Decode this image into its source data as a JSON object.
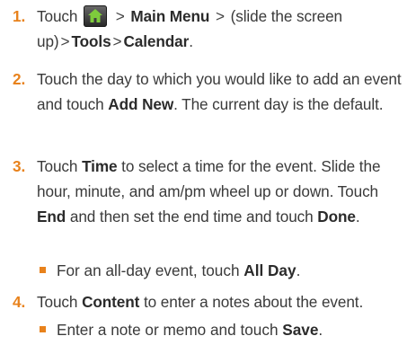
{
  "steps": [
    {
      "number": "1.",
      "prefix": "Touch",
      "icon": "home-icon",
      "path": [
        "Main Menu",
        "(slide the screen up)",
        "Tools",
        "Calendar"
      ],
      "separator": ">",
      "end": "."
    },
    {
      "number": "2.",
      "text_before": "Touch the day to which you would like to add an event and touch",
      "bold": "Add New",
      "text_after": ". The current day is the default."
    },
    {
      "number": "3.",
      "t1": "Touch",
      "b1": "Time",
      "t2": "to select a time for the event. Slide the hour, minute, and am/pm wheel up or down. Touch",
      "b2": "End",
      "t3": "and then set the end time and touch",
      "b3": "Done",
      "t4": ".",
      "sub": {
        "text": "For an all-day event, touch",
        "bold": "All Day",
        "end": "."
      }
    },
    {
      "number": "4.",
      "t1": "Touch",
      "b1": "Content",
      "t2": "to enter a notes about the event.",
      "sub": {
        "text": "Enter a note or memo and touch",
        "bold": "Save",
        "end": "."
      }
    }
  ],
  "colors": {
    "accent": "#e8821c",
    "text": "#3a3a3a"
  }
}
